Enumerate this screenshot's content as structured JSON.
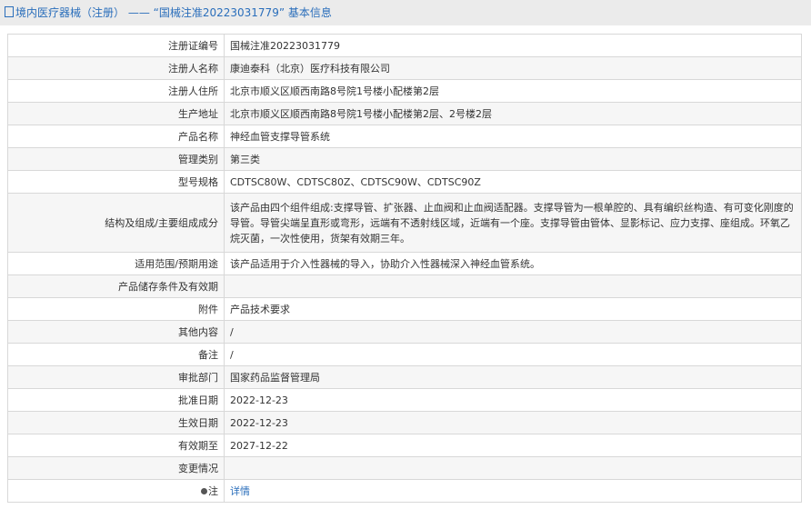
{
  "header": {
    "title": "境内医疗器械（注册） —— “国械注准20223031779” 基本信息"
  },
  "rows": [
    {
      "label": "注册证编号",
      "value": "国械注准20223031779"
    },
    {
      "label": "注册人名称",
      "value": "康迪泰科（北京）医疗科技有限公司"
    },
    {
      "label": "注册人住所",
      "value": "北京市顺义区顺西南路8号院1号楼小配楼第2层"
    },
    {
      "label": "生产地址",
      "value": "北京市顺义区顺西南路8号院1号楼小配楼第2层、2号楼2层"
    },
    {
      "label": "产品名称",
      "value": "神经血管支撑导管系统"
    },
    {
      "label": "管理类别",
      "value": "第三类"
    },
    {
      "label": "型号规格",
      "value": "CDTSC80W、CDTSC80Z、CDTSC90W、CDTSC90Z"
    },
    {
      "label": "结构及组成/主要组成成分",
      "value": "该产品由四个组件组成:支撑导管、扩张器、止血阀和止血阀适配器。支撑导管为一根单腔的、具有编织丝构造、有可变化刚度的导管。导管尖端呈直形或弯形，远端有不透射线区域，近端有一个座。支撑导管由管体、显影标记、应力支撑、座组成。环氧乙烷灭菌，一次性使用，货架有效期三年。"
    },
    {
      "label": "适用范围/预期用途",
      "value": "该产品适用于介入性器械的导入，协助介入性器械深入神经血管系统。"
    },
    {
      "label": "产品储存条件及有效期",
      "value": ""
    },
    {
      "label": "附件",
      "value": "产品技术要求"
    },
    {
      "label": "其他内容",
      "value": "/"
    },
    {
      "label": "备注",
      "value": "/"
    },
    {
      "label": "审批部门",
      "value": "国家药品监督管理局"
    },
    {
      "label": "批准日期",
      "value": "2022-12-23"
    },
    {
      "label": "生效日期",
      "value": "2022-12-23"
    },
    {
      "label": "有效期至",
      "value": "2027-12-22"
    },
    {
      "label": "变更情况",
      "value": ""
    }
  ],
  "note": {
    "label": "注",
    "link": "详情"
  }
}
